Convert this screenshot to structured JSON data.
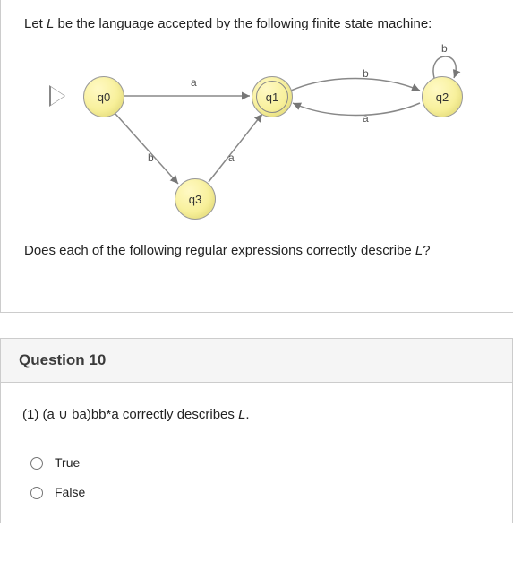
{
  "preamble": {
    "intro_prefix": "Let ",
    "intro_var": "L",
    "intro_suffix": " be the language accepted by the following finite state machine:",
    "question_prefix": "Does each of the following regular expressions correctly describe ",
    "question_var": "L",
    "question_suffix": "?"
  },
  "fsm": {
    "states": {
      "q0": "q0",
      "q1": "q1",
      "q2": "q2",
      "q3": "q3"
    },
    "labels": {
      "a_q0_q1": "a",
      "b_q1_q2_top": "b",
      "a_q2_q1_bot": "a",
      "b_q2_loop": "b",
      "b_q0_q3": "b",
      "a_q3_q1": "a"
    }
  },
  "question": {
    "header": "Question 10",
    "statement_prefix": "(1) (a ∪ ba)bb*a  correctly describes ",
    "statement_var": "L",
    "statement_suffix": ".",
    "options": {
      "true": "True",
      "false": "False"
    }
  }
}
